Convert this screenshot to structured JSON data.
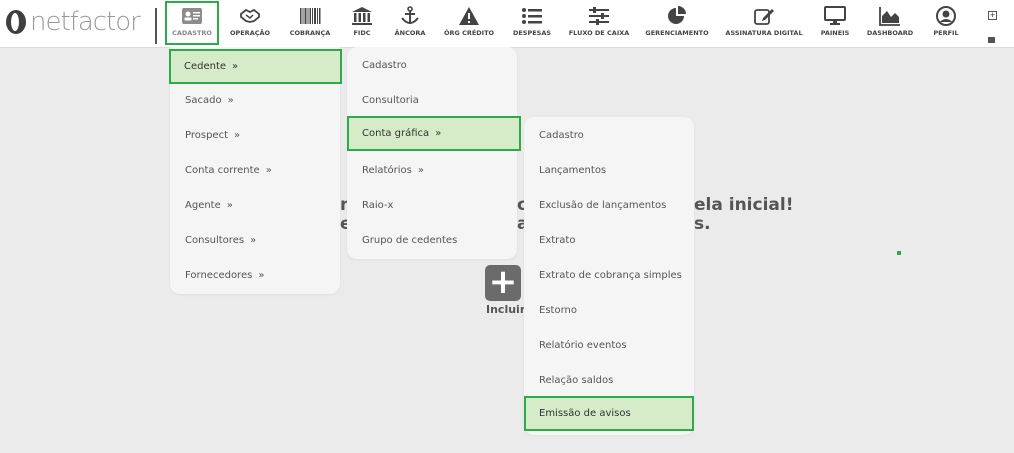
{
  "brand": {
    "logo_text": "netfactor"
  },
  "nav": [
    {
      "label": "CADASTRO",
      "icon": "id-card-icon"
    },
    {
      "label": "OPERAÇÃO",
      "icon": "handshake-icon"
    },
    {
      "label": "COBRANÇA",
      "icon": "barcode-icon"
    },
    {
      "label": "FIDC",
      "icon": "bank-icon"
    },
    {
      "label": "ÂNCORA",
      "icon": "anchor-icon"
    },
    {
      "label": "ÓRG CRÉDITO",
      "icon": "warning-icon"
    },
    {
      "label": "DESPESAS",
      "icon": "list-icon"
    },
    {
      "label": "FLUXO DE CAIXA",
      "icon": "sliders-icon"
    },
    {
      "label": "GERENCIAMENTO",
      "icon": "pie-chart-icon"
    },
    {
      "label": "ASSINATURA DIGITAL",
      "icon": "edit-icon"
    },
    {
      "label": "PAINEIS",
      "icon": "monitor-icon"
    },
    {
      "label": "DASHBOARD",
      "icon": "area-chart-icon"
    },
    {
      "label": "PERFIL",
      "icon": "user-circle-icon"
    }
  ],
  "menu1": [
    {
      "label": "Cedente",
      "chev": "»"
    },
    {
      "label": "Sacado",
      "chev": "»"
    },
    {
      "label": "Prospect",
      "chev": "»"
    },
    {
      "label": "Conta corrente",
      "chev": "»"
    },
    {
      "label": "Agente",
      "chev": "»"
    },
    {
      "label": "Consultores",
      "chev": "»"
    },
    {
      "label": "Fornecedores",
      "chev": "»"
    }
  ],
  "menu2": [
    {
      "label": "Cadastro",
      "chev": ""
    },
    {
      "label": "Consultoria",
      "chev": ""
    },
    {
      "label": "Conta gráfica",
      "chev": "»"
    },
    {
      "label": "Relatórios",
      "chev": "»"
    },
    {
      "label": "Raio-x",
      "chev": ""
    },
    {
      "label": "Grupo de cedentes",
      "chev": ""
    }
  ],
  "menu3": [
    {
      "label": "Cadastro"
    },
    {
      "label": "Lançamentos"
    },
    {
      "label": "Exclusão de lançamentos"
    },
    {
      "label": "Extrato"
    },
    {
      "label": "Extrato de cobrança simples"
    },
    {
      "label": "Estorno"
    },
    {
      "label": "Relatório eventos"
    },
    {
      "label": "Relação saldos"
    },
    {
      "label": "Emissão de avisos"
    }
  ],
  "background": {
    "line1_left": "n",
    "line1_mid": "c",
    "line1_right": "ela inicial!",
    "line2_left": "e",
    "line2_mid": "a",
    "line2_right": "s."
  },
  "incluir": {
    "icon": "+",
    "label": "Incluir"
  },
  "colors": {
    "highlight": "#2eaa4a",
    "active_bg": "#d6ebc8"
  }
}
